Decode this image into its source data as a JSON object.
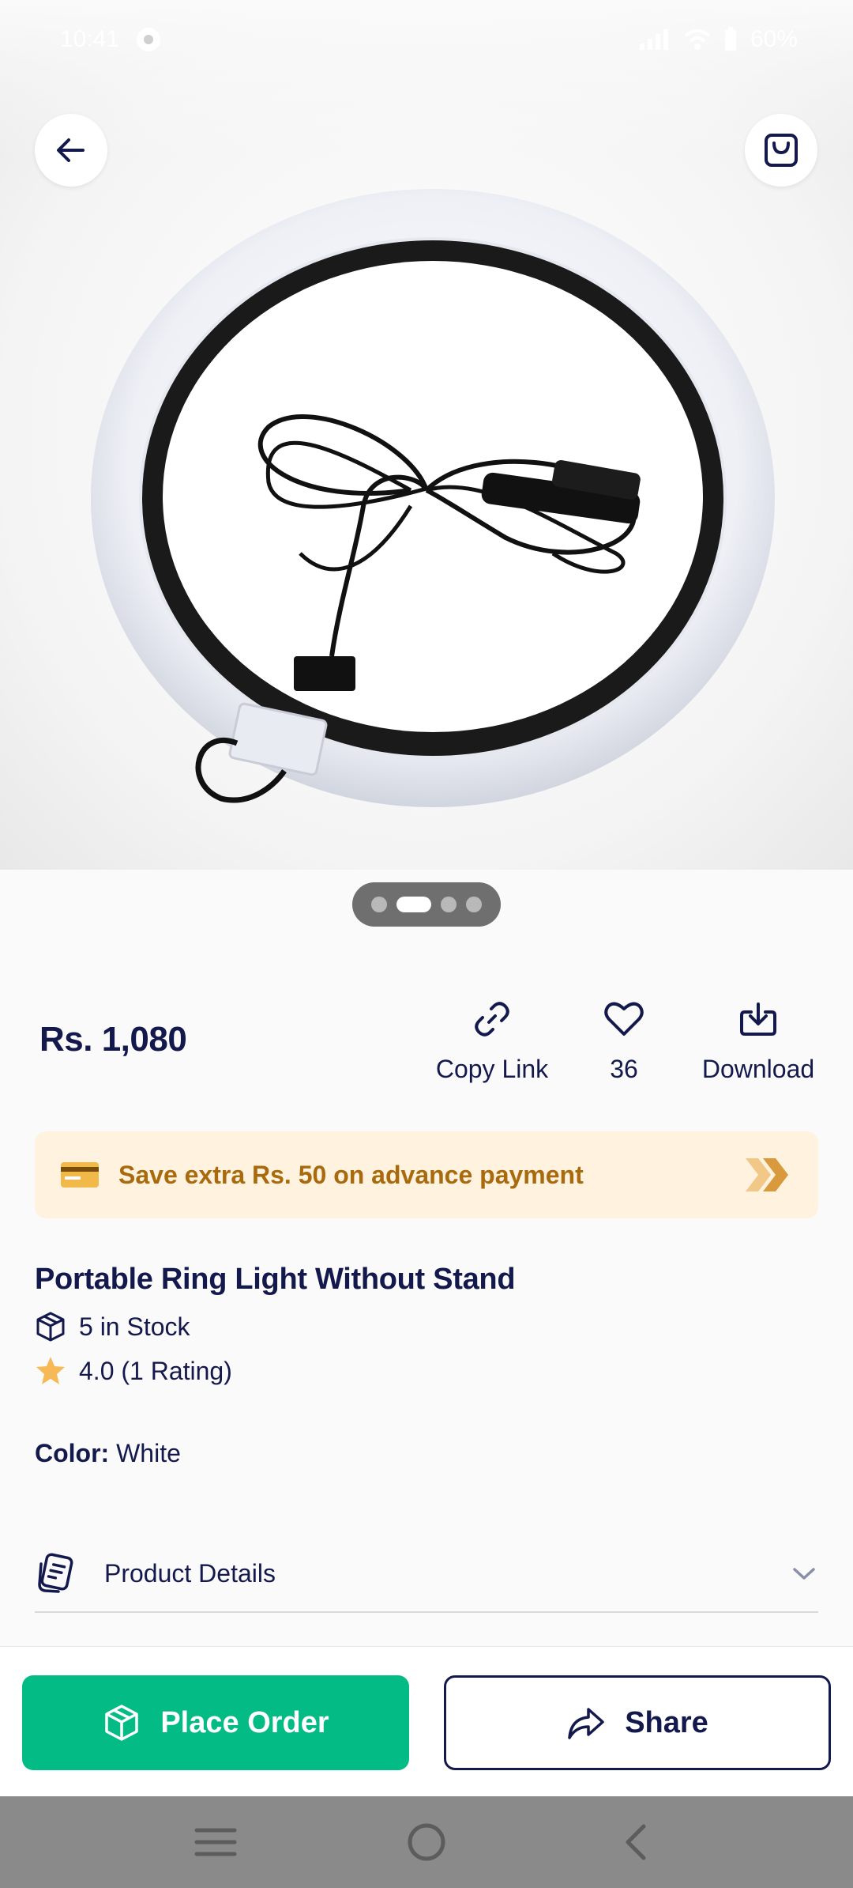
{
  "status_bar": {
    "time": "10:41",
    "battery": "60%"
  },
  "product": {
    "price": "Rs. 1,080",
    "title": "Portable Ring Light Without Stand",
    "stock": "5 in Stock",
    "rating": "4.0 (1 Rating)",
    "color_label": "Color:",
    "color_value": "White",
    "image_count": 4,
    "active_image": 2
  },
  "actions": {
    "copy_link": "Copy Link",
    "likes": "36",
    "download": "Download"
  },
  "promo": {
    "text": "Save extra Rs. 50 on advance payment"
  },
  "details": {
    "label": "Product Details"
  },
  "bottom": {
    "place_order": "Place Order",
    "share": "Share"
  },
  "colors": {
    "brand_navy": "#14194d",
    "primary_green": "#02bb85",
    "promo_bg": "#fff2df",
    "promo_text": "#a86a0c",
    "star": "#f7b955"
  }
}
